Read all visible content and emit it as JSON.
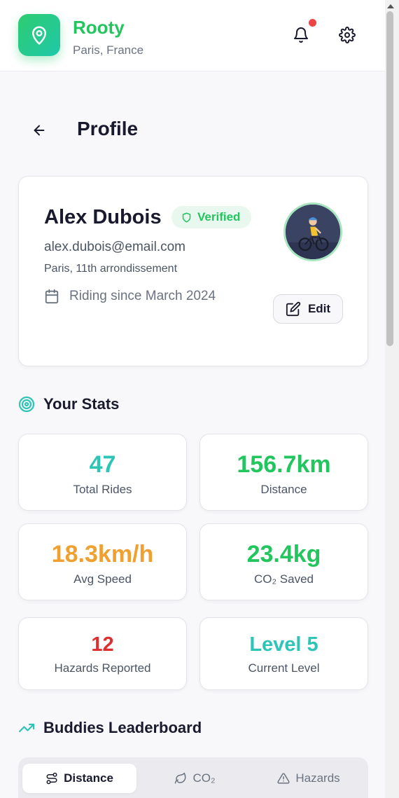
{
  "header": {
    "brand": "Rooty",
    "location": "Paris, France",
    "icons": [
      "map-pin-icon",
      "bell-icon",
      "gear-icon"
    ],
    "notification_dot": true
  },
  "page": {
    "title": "Profile"
  },
  "profile": {
    "name": "Alex Dubois",
    "verified_label": "Verified",
    "email": "alex.dubois@email.com",
    "district": "Paris, 11th arrondissement",
    "riding_since": "Riding since March 2024",
    "edit_label": "Edit"
  },
  "stats": {
    "heading": "Your Stats",
    "items": [
      {
        "value": "47",
        "label": "Total Rides",
        "color": "#2ec4b6"
      },
      {
        "value": "156.7km",
        "label": "Distance",
        "color": "#22c55e"
      },
      {
        "value": "18.3km/h",
        "label": "Avg Speed",
        "color": "#f0a030"
      },
      {
        "value": "23.4kg",
        "label": "CO₂ Saved",
        "color": "#22c55e"
      },
      {
        "value": "12",
        "label": "Hazards Reported",
        "color": "#dc2f2f"
      },
      {
        "value": "Level 5",
        "label": "Current Level",
        "color": "#2ec4b6"
      }
    ]
  },
  "leaderboard": {
    "heading": "Buddies Leaderboard",
    "tabs": [
      {
        "label": "Distance",
        "active": true
      },
      {
        "label": "CO₂",
        "active": false
      },
      {
        "label": "Hazards",
        "active": false
      }
    ]
  },
  "colors": {
    "brand_green": "#22c55e",
    "teal": "#2ec4b6",
    "alert_red": "#ef4444"
  }
}
